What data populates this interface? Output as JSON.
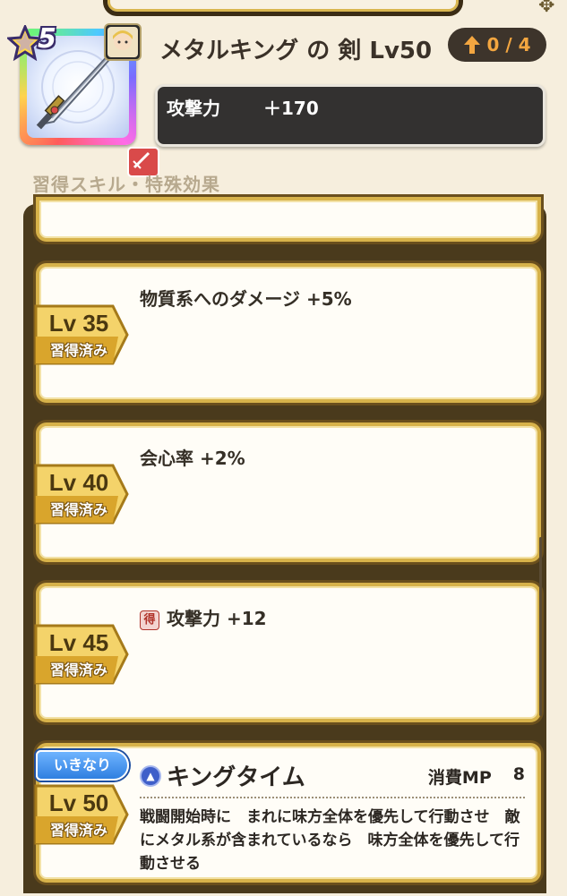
{
  "item": {
    "rarity": "5",
    "name": "メタルキング の 剣 Lv50",
    "upgrade": "0 / 4",
    "stat": {
      "label": "攻撃力",
      "value": "＋170"
    }
  },
  "section_label": "習得スキル・特殊効果",
  "cards": [
    {
      "lv": "Lv 35",
      "status": "習得済み",
      "text": "物質系へのダメージ +5%"
    },
    {
      "lv": "Lv 40",
      "status": "習得済み",
      "text": "会心率 +2%"
    },
    {
      "lv": "Lv 45",
      "status": "習得済み",
      "tag": "得",
      "text": "攻撃力 +12"
    }
  ],
  "skill": {
    "tag": "いきなり",
    "lv": "Lv 50",
    "status": "習得済み",
    "name": "キングタイム",
    "mp_label": "消費MP",
    "mp_value": "8",
    "description": "戦闘開始時に　まれに味方全体を優先して行動させ　敵にメタル系が含まれているなら　味方全体を優先して行動させる"
  },
  "colors": {
    "gold": "#d7b24a",
    "frame": "#4a3a1c",
    "pill": "#3d342b",
    "upgrade": "#f3a640"
  }
}
